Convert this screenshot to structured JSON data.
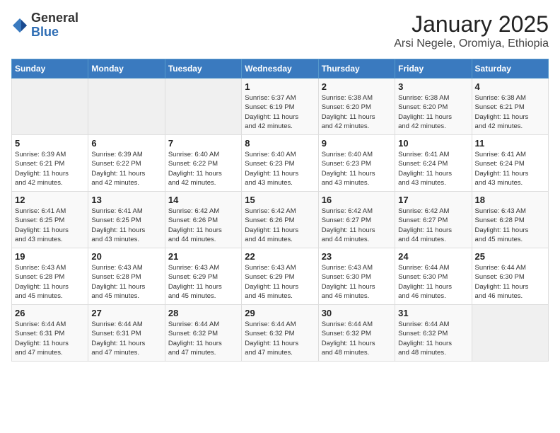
{
  "header": {
    "logo_general": "General",
    "logo_blue": "Blue",
    "month_title": "January 2025",
    "location": "Arsi Negele, Oromiya, Ethiopia"
  },
  "days_of_week": [
    "Sunday",
    "Monday",
    "Tuesday",
    "Wednesday",
    "Thursday",
    "Friday",
    "Saturday"
  ],
  "weeks": [
    [
      {
        "day": "",
        "info": ""
      },
      {
        "day": "",
        "info": ""
      },
      {
        "day": "",
        "info": ""
      },
      {
        "day": "1",
        "info": "Sunrise: 6:37 AM\nSunset: 6:19 PM\nDaylight: 11 hours\nand 42 minutes."
      },
      {
        "day": "2",
        "info": "Sunrise: 6:38 AM\nSunset: 6:20 PM\nDaylight: 11 hours\nand 42 minutes."
      },
      {
        "day": "3",
        "info": "Sunrise: 6:38 AM\nSunset: 6:20 PM\nDaylight: 11 hours\nand 42 minutes."
      },
      {
        "day": "4",
        "info": "Sunrise: 6:38 AM\nSunset: 6:21 PM\nDaylight: 11 hours\nand 42 minutes."
      }
    ],
    [
      {
        "day": "5",
        "info": "Sunrise: 6:39 AM\nSunset: 6:21 PM\nDaylight: 11 hours\nand 42 minutes."
      },
      {
        "day": "6",
        "info": "Sunrise: 6:39 AM\nSunset: 6:22 PM\nDaylight: 11 hours\nand 42 minutes."
      },
      {
        "day": "7",
        "info": "Sunrise: 6:40 AM\nSunset: 6:22 PM\nDaylight: 11 hours\nand 42 minutes."
      },
      {
        "day": "8",
        "info": "Sunrise: 6:40 AM\nSunset: 6:23 PM\nDaylight: 11 hours\nand 43 minutes."
      },
      {
        "day": "9",
        "info": "Sunrise: 6:40 AM\nSunset: 6:23 PM\nDaylight: 11 hours\nand 43 minutes."
      },
      {
        "day": "10",
        "info": "Sunrise: 6:41 AM\nSunset: 6:24 PM\nDaylight: 11 hours\nand 43 minutes."
      },
      {
        "day": "11",
        "info": "Sunrise: 6:41 AM\nSunset: 6:24 PM\nDaylight: 11 hours\nand 43 minutes."
      }
    ],
    [
      {
        "day": "12",
        "info": "Sunrise: 6:41 AM\nSunset: 6:25 PM\nDaylight: 11 hours\nand 43 minutes."
      },
      {
        "day": "13",
        "info": "Sunrise: 6:41 AM\nSunset: 6:25 PM\nDaylight: 11 hours\nand 43 minutes."
      },
      {
        "day": "14",
        "info": "Sunrise: 6:42 AM\nSunset: 6:26 PM\nDaylight: 11 hours\nand 44 minutes."
      },
      {
        "day": "15",
        "info": "Sunrise: 6:42 AM\nSunset: 6:26 PM\nDaylight: 11 hours\nand 44 minutes."
      },
      {
        "day": "16",
        "info": "Sunrise: 6:42 AM\nSunset: 6:27 PM\nDaylight: 11 hours\nand 44 minutes."
      },
      {
        "day": "17",
        "info": "Sunrise: 6:42 AM\nSunset: 6:27 PM\nDaylight: 11 hours\nand 44 minutes."
      },
      {
        "day": "18",
        "info": "Sunrise: 6:43 AM\nSunset: 6:28 PM\nDaylight: 11 hours\nand 45 minutes."
      }
    ],
    [
      {
        "day": "19",
        "info": "Sunrise: 6:43 AM\nSunset: 6:28 PM\nDaylight: 11 hours\nand 45 minutes."
      },
      {
        "day": "20",
        "info": "Sunrise: 6:43 AM\nSunset: 6:28 PM\nDaylight: 11 hours\nand 45 minutes."
      },
      {
        "day": "21",
        "info": "Sunrise: 6:43 AM\nSunset: 6:29 PM\nDaylight: 11 hours\nand 45 minutes."
      },
      {
        "day": "22",
        "info": "Sunrise: 6:43 AM\nSunset: 6:29 PM\nDaylight: 11 hours\nand 45 minutes."
      },
      {
        "day": "23",
        "info": "Sunrise: 6:43 AM\nSunset: 6:30 PM\nDaylight: 11 hours\nand 46 minutes."
      },
      {
        "day": "24",
        "info": "Sunrise: 6:44 AM\nSunset: 6:30 PM\nDaylight: 11 hours\nand 46 minutes."
      },
      {
        "day": "25",
        "info": "Sunrise: 6:44 AM\nSunset: 6:30 PM\nDaylight: 11 hours\nand 46 minutes."
      }
    ],
    [
      {
        "day": "26",
        "info": "Sunrise: 6:44 AM\nSunset: 6:31 PM\nDaylight: 11 hours\nand 47 minutes."
      },
      {
        "day": "27",
        "info": "Sunrise: 6:44 AM\nSunset: 6:31 PM\nDaylight: 11 hours\nand 47 minutes."
      },
      {
        "day": "28",
        "info": "Sunrise: 6:44 AM\nSunset: 6:32 PM\nDaylight: 11 hours\nand 47 minutes."
      },
      {
        "day": "29",
        "info": "Sunrise: 6:44 AM\nSunset: 6:32 PM\nDaylight: 11 hours\nand 47 minutes."
      },
      {
        "day": "30",
        "info": "Sunrise: 6:44 AM\nSunset: 6:32 PM\nDaylight: 11 hours\nand 48 minutes."
      },
      {
        "day": "31",
        "info": "Sunrise: 6:44 AM\nSunset: 6:32 PM\nDaylight: 11 hours\nand 48 minutes."
      },
      {
        "day": "",
        "info": ""
      }
    ]
  ]
}
